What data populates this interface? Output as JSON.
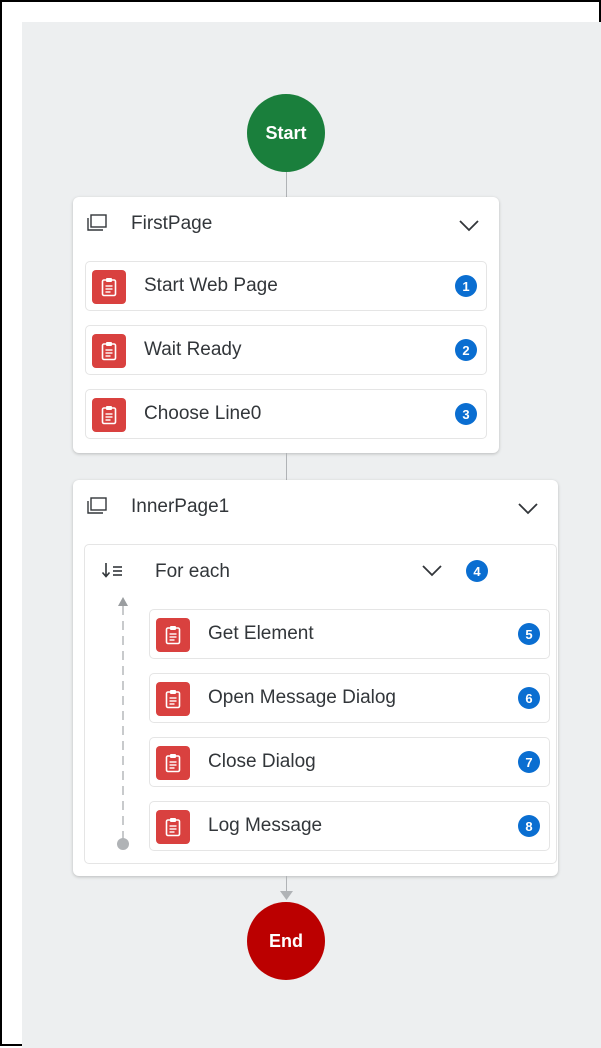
{
  "flow": {
    "start_label": "Start",
    "end_label": "End"
  },
  "colors": {
    "canvas_bg": "#edeff0",
    "start": "#1a7f3c",
    "end": "#bb0000",
    "activity_icon": "#d9413f",
    "step_badge": "#0a6ed1"
  },
  "groups": [
    {
      "title": "FirstPage",
      "icon": "page-icon",
      "steps": [
        {
          "label": "Start Web Page",
          "number": "1",
          "icon": "clipboard-icon"
        },
        {
          "label": "Wait Ready",
          "number": "2",
          "icon": "clipboard-icon"
        },
        {
          "label": "Choose Line0",
          "number": "3",
          "icon": "clipboard-icon"
        }
      ]
    },
    {
      "title": "InnerPage1",
      "icon": "page-icon",
      "loop": {
        "title": "For each",
        "number": "4",
        "icon": "loop-sort-icon",
        "steps": [
          {
            "label": "Get Element",
            "number": "5",
            "icon": "clipboard-icon"
          },
          {
            "label": "Open Message Dialog",
            "number": "6",
            "icon": "clipboard-icon"
          },
          {
            "label": "Close Dialog",
            "number": "7",
            "icon": "clipboard-icon"
          },
          {
            "label": "Log Message",
            "number": "8",
            "icon": "clipboard-icon"
          }
        ]
      }
    }
  ]
}
